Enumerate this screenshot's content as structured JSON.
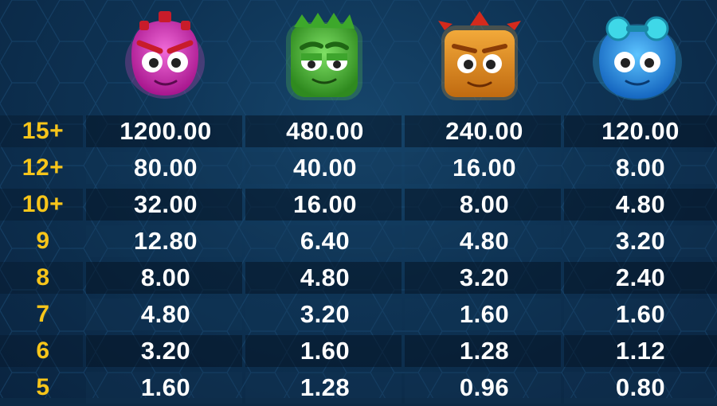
{
  "symbols": [
    {
      "name": "pink-reactoonz-alien",
      "color": "#d43bb8"
    },
    {
      "name": "green-reactoonz-alien",
      "color": "#4cc23a"
    },
    {
      "name": "orange-reactoonz-alien",
      "color": "#e0941e"
    },
    {
      "name": "blue-reactoonz-alien",
      "color": "#2e9ee6"
    }
  ],
  "colors": {
    "count_text": "#f7c51a",
    "value_text": "#ffffff",
    "background": "#0c2a46"
  },
  "paytable": {
    "rows": [
      {
        "count": "15+",
        "values": [
          "1200.00",
          "480.00",
          "240.00",
          "120.00"
        ]
      },
      {
        "count": "12+",
        "values": [
          "80.00",
          "40.00",
          "16.00",
          "8.00"
        ]
      },
      {
        "count": "10+",
        "values": [
          "32.00",
          "16.00",
          "8.00",
          "4.80"
        ]
      },
      {
        "count": "9",
        "values": [
          "12.80",
          "6.40",
          "4.80",
          "3.20"
        ]
      },
      {
        "count": "8",
        "values": [
          "8.00",
          "4.80",
          "3.20",
          "2.40"
        ]
      },
      {
        "count": "7",
        "values": [
          "4.80",
          "3.20",
          "1.60",
          "1.60"
        ]
      },
      {
        "count": "6",
        "values": [
          "3.20",
          "1.60",
          "1.28",
          "1.12"
        ]
      },
      {
        "count": "5",
        "values": [
          "1.60",
          "1.28",
          "0.96",
          "0.80"
        ]
      }
    ]
  }
}
